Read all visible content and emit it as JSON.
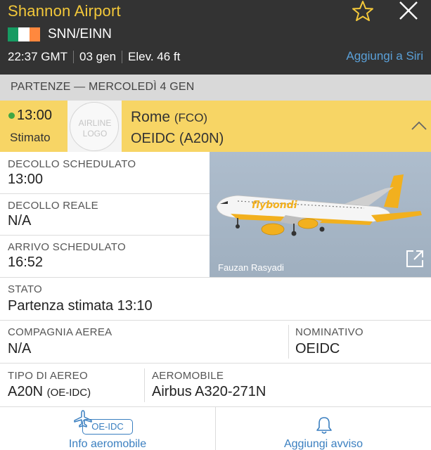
{
  "header": {
    "airport_name": "Shannon Airport",
    "codes": "SNN/EINN",
    "local_time": "22:37 GMT",
    "date": "03 gen",
    "elevation": "Elev. 46 ft",
    "siri_link": "Aggiungi a Siri",
    "flag_colors": [
      "#169b62",
      "#ffffff",
      "#ff883e"
    ],
    "title_color": "#f3c83a"
  },
  "section": {
    "title": "PARTENZE — MERCOLEDÌ 4 GEN"
  },
  "flight": {
    "time": "13:00",
    "status": "Stimato",
    "logo_placeholder": "AIRLINE LOGO",
    "destination": "Rome",
    "destination_code": "(FCO)",
    "registration_type": "OEIDC (A20N)",
    "row_color": "#f7d565"
  },
  "details": {
    "sched_departure_label": "DECOLLO SCHEDULATO",
    "sched_departure_value": "13:00",
    "actual_departure_label": "DECOLLO REALE",
    "actual_departure_value": "N/A",
    "sched_arrival_label": "ARRIVO SCHEDULATO",
    "sched_arrival_value": "16:52",
    "status_label": "STATO",
    "status_value": "Partenza stimata 13:10",
    "airline_label": "COMPAGNIA AEREA",
    "airline_value": "N/A",
    "callsign_label": "NOMINATIVO",
    "callsign_value": "OEIDC",
    "aircraft_type_label": "TIPO DI AEREO",
    "aircraft_type_value": "A20N",
    "aircraft_type_reg": "(OE-IDC)",
    "aircraft_label": "AEROMOBILE",
    "aircraft_value": "Airbus A320-271N",
    "photo_credit": "Fauzan Rasyadi",
    "photo_livery_text": "flybondi"
  },
  "bottom_bar": {
    "aircraft_info_label": "Info aeromobile",
    "registration_badge": "OE-IDC",
    "add_alert_label": "Aggiungi avviso",
    "accent_color": "#3a7fc0"
  }
}
